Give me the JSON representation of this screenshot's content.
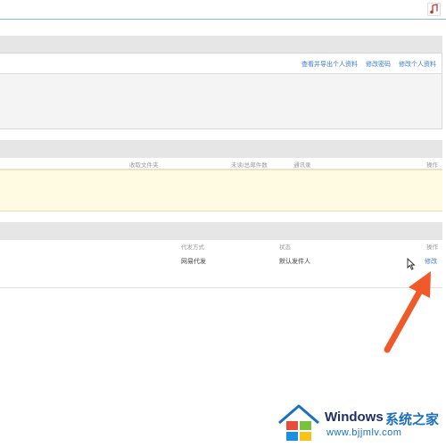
{
  "panel1": {
    "links": [
      "查看并导出个人资料",
      "修改密码",
      "修改个人资料"
    ]
  },
  "table1": {
    "columns": [
      "收取文件夹",
      "未读/总邮件数",
      "通讯录",
      "操作"
    ]
  },
  "table2": {
    "columns": [
      "代发方式",
      "状态",
      "操作"
    ],
    "rows": [
      {
        "method": "网易代发",
        "status": "默认发件人",
        "action": "修改"
      }
    ]
  },
  "watermark": {
    "brand": "Windows",
    "suffix": "系统之家",
    "url": "www.bjjmlv.com"
  },
  "colors": {
    "link": "#3a7bd5",
    "arrow": "#f0592a",
    "yellow_bg": "#fffbe3",
    "section_gray": "#e6e6e6"
  },
  "icons": [
    "music-icon",
    "mouse-cursor-icon",
    "annotation-arrow-icon",
    "windows-logo-icon"
  ]
}
